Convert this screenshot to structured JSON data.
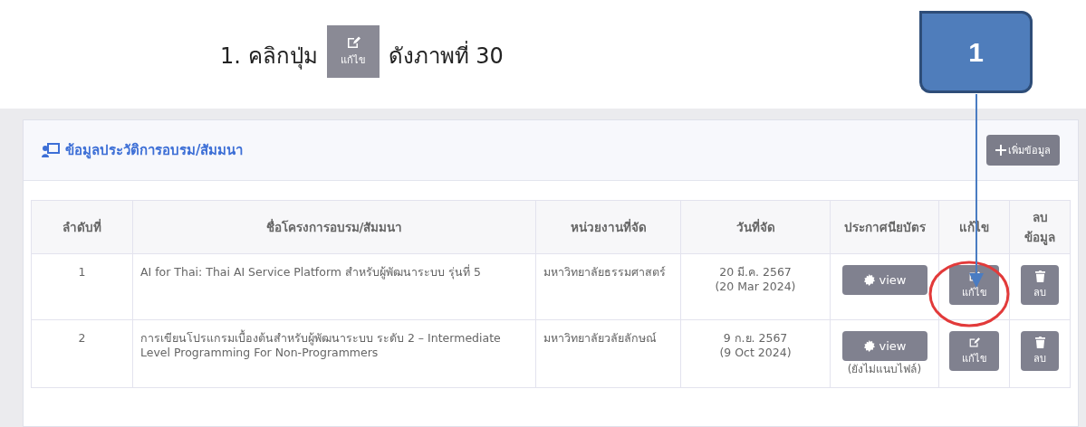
{
  "instruction": {
    "before": "1. คลิกปุ่ม",
    "button_label": "แก้ไข",
    "after": "ดังภาพที่ 30"
  },
  "callout": {
    "label": "1"
  },
  "panel": {
    "title": "ข้อมูลประวัติการอบรม/สัมมนา",
    "add_button": "เพิ่มข้อมูล"
  },
  "table": {
    "columns": [
      "ลำดับที่",
      "ชื่อโครงการอบรม/สัมมนา",
      "หน่วยงานที่จัด",
      "วันที่จัด",
      "ประกาศนียบัตร",
      "แก้ไข",
      "ลบ ข้อมูล"
    ],
    "rows": [
      {
        "no": "1",
        "name": "AI for Thai: Thai AI Service Platform สำหรับผู้พัฒนาระบบ รุ่นที่ 5",
        "organizer": "มหาวิทยาลัยธรรมศาสตร์",
        "date": "20 มี.ค. 2567",
        "date_en": "(20 Mar 2024)",
        "view": "view",
        "edit": "แก้ไข",
        "delete": "ลบ"
      },
      {
        "no": "2",
        "name": "การเขียนโปรแกรมเบื้องต้นสำหรับผู้พัฒนาระบบ ระดับ 2 – Intermediate Level Programming For Non-Programmers",
        "organizer": "มหาวิทยาลัยวลัยลักษณ์",
        "date": "9 ก.ย. 2567",
        "date_en": "(9 Oct 2024)",
        "view": "view",
        "note": "(ยังไม่แนบไฟล์)",
        "edit": "แก้ไข",
        "delete": "ลบ"
      }
    ]
  }
}
